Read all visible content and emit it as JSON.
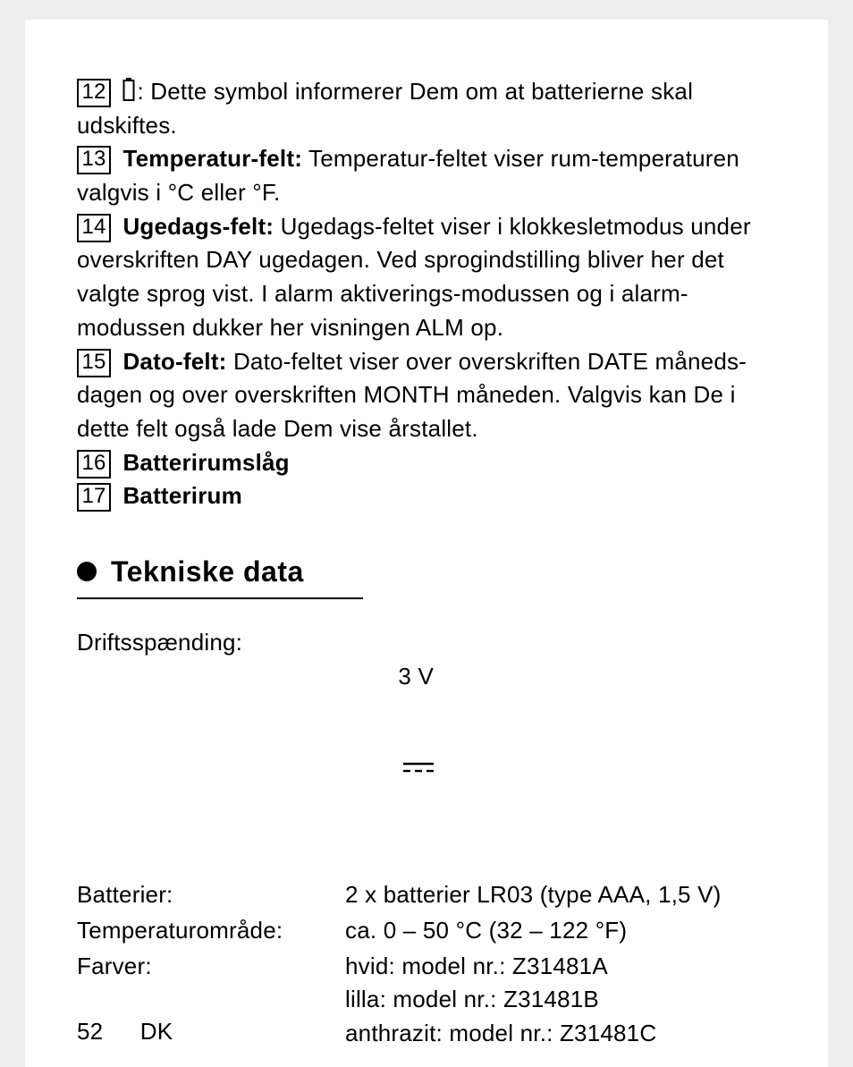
{
  "entries": [
    {
      "num": "12",
      "label": "",
      "text": ": Dette symbol informerer Dem om at batterierne skal udskiftes.",
      "icon": "battery"
    },
    {
      "num": "13",
      "label": "Temperatur-felt:",
      "text": " Temperatur-feltet viser rum-temperaturen valgvis i °C eller °F."
    },
    {
      "num": "14",
      "label": "Ugedags-felt:",
      "text": " Ugedags-feltet viser i klokkesletmodus under overskriften DAY ugedagen. Ved sprogindstilling bliver her det valgte sprog vist. I alarm aktiverings-modussen og i alarm-modussen dukker her visningen ALM op."
    },
    {
      "num": "15",
      "label": "Dato-felt:",
      "text": " Dato-feltet viser over overskriften DATE måneds-dagen og over overskriften MONTH måneden. Valgvis kan De i dette felt også lade Dem vise årstallet."
    },
    {
      "num": "16",
      "label": "Batterirumslåg",
      "text": ""
    },
    {
      "num": "17",
      "label": "Batterirum",
      "text": ""
    }
  ],
  "section_title": "Tekniske data",
  "specs": [
    {
      "label": "Driftsspænding:",
      "value": "3 V",
      "dc": true
    },
    {
      "label": "Batterier:",
      "value": "2 x batterier LR03 (type AAA, 1,5 V)"
    },
    {
      "label": "Temperaturområde:",
      "value": "ca. 0 – 50 °C (32 – 122 °F)"
    },
    {
      "label": "Farver:",
      "value": "hvid: model nr.: Z31481A\nlilla: model nr.: Z31481B\nanthrazit: model nr.: Z31481C"
    }
  ],
  "page_number": "52",
  "lang": "DK"
}
